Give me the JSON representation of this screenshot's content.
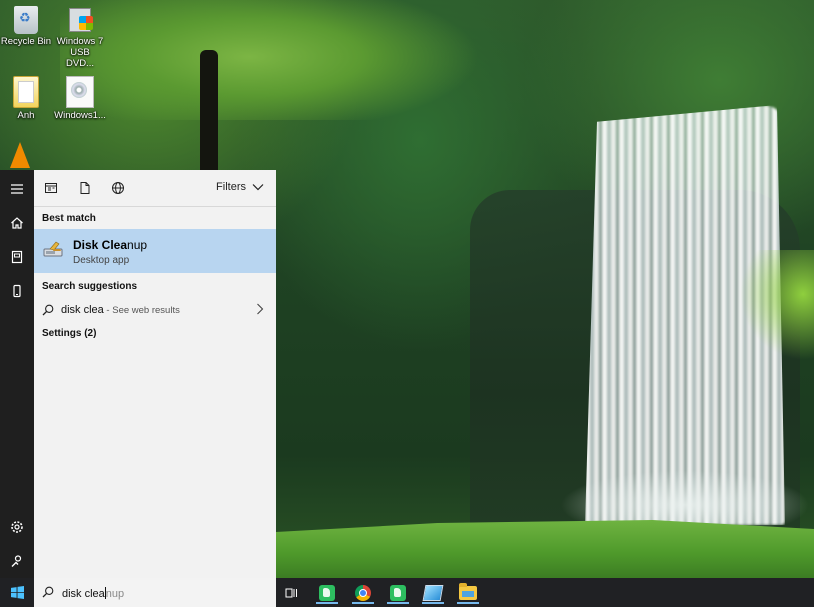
{
  "desktop": {
    "icons": [
      {
        "label": "Recycle Bin",
        "icon": "recycle-bin-icon"
      },
      {
        "label": "Windows 7 USB DVD...",
        "icon": "windows-usb-tool-icon"
      },
      {
        "label": "Anh",
        "icon": "folder-icon"
      },
      {
        "label": "Windows1...",
        "icon": "disc-image-icon"
      },
      {
        "label": "",
        "icon": "vlc-icon"
      }
    ]
  },
  "rail": {
    "items": [
      "hamburger-icon",
      "home-icon",
      "documents-icon",
      "phone-icon",
      "settings-icon",
      "user-icon"
    ]
  },
  "search_panel": {
    "filters_label": "Filters",
    "best_match_heading": "Best match",
    "best_match": {
      "title_bold": "Disk Clea",
      "title_rest": "nup",
      "subtitle": "Desktop app",
      "icon": "disk-cleanup-icon"
    },
    "suggestions_heading": "Search suggestions",
    "suggestion": {
      "query": "disk clea",
      "suffix": " - See web results"
    },
    "settings_heading": "Settings (2)"
  },
  "taskbar": {
    "search_typed": "disk clea",
    "search_autocomplete": "nup",
    "apps": [
      {
        "icon": "task-view-icon",
        "running": false
      },
      {
        "icon": "evernote-icon",
        "running": true
      },
      {
        "icon": "chrome-icon",
        "running": true
      },
      {
        "icon": "evernote-icon",
        "running": true
      },
      {
        "icon": "notepad-icon",
        "running": true
      },
      {
        "icon": "file-explorer-icon",
        "running": true
      }
    ]
  },
  "colors": {
    "taskbar_bg": "#202124",
    "panel_bg": "#f2f2f2",
    "selection": "#b8d5f0",
    "running_indicator": "#76b9ed"
  }
}
